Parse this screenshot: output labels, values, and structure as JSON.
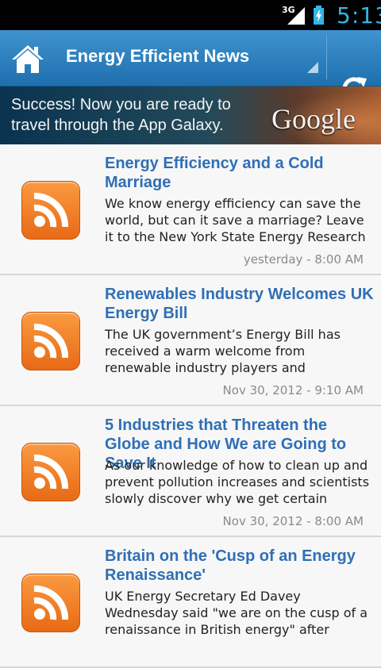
{
  "status_bar": {
    "network": "3G",
    "time": "5:13"
  },
  "action_bar": {
    "title": "Energy Efficient News"
  },
  "ad": {
    "text": "Success! Now you are ready to travel through the App Galaxy.",
    "logo": "Google"
  },
  "colors": {
    "accent": "#33b5e5",
    "title_blue": "#2f6fb6",
    "rss_orange": "#f08a2c"
  },
  "articles": [
    {
      "title": "Energy Efficiency and a Cold Marriage",
      "description": "We know energy efficiency can save the world, but can it save a marriage? Leave it to the New York State Energy Research and",
      "date": "yesterday - 8:00 AM",
      "icon": "rss-feed-icon"
    },
    {
      "title": "Renewables Industry Welcomes UK Energy Bill",
      "description": "The UK government’s Energy Bill has received a warm welcome from renewable industry players and representatives.",
      "date": "Nov 30, 2012 - 9:10 AM",
      "icon": "rss-feed-icon"
    },
    {
      "title": "5 Industries that Threaten the Globe and How We are Going to Save It",
      "description": "As our knowledge of how to clean up and prevent pollution increases and scientists slowly discover why we get certain",
      "date": "Nov 30, 2012 - 8:00 AM",
      "icon": "rss-feed-icon"
    },
    {
      "title": "Britain on the 'Cusp of an Energy Renaissance'",
      "description": "UK Energy Secretary Ed Davey Wednesday said \"we are on the cusp of a renaissance in British energy\" after unveiling the",
      "date": "",
      "icon": "rss-feed-icon"
    }
  ]
}
